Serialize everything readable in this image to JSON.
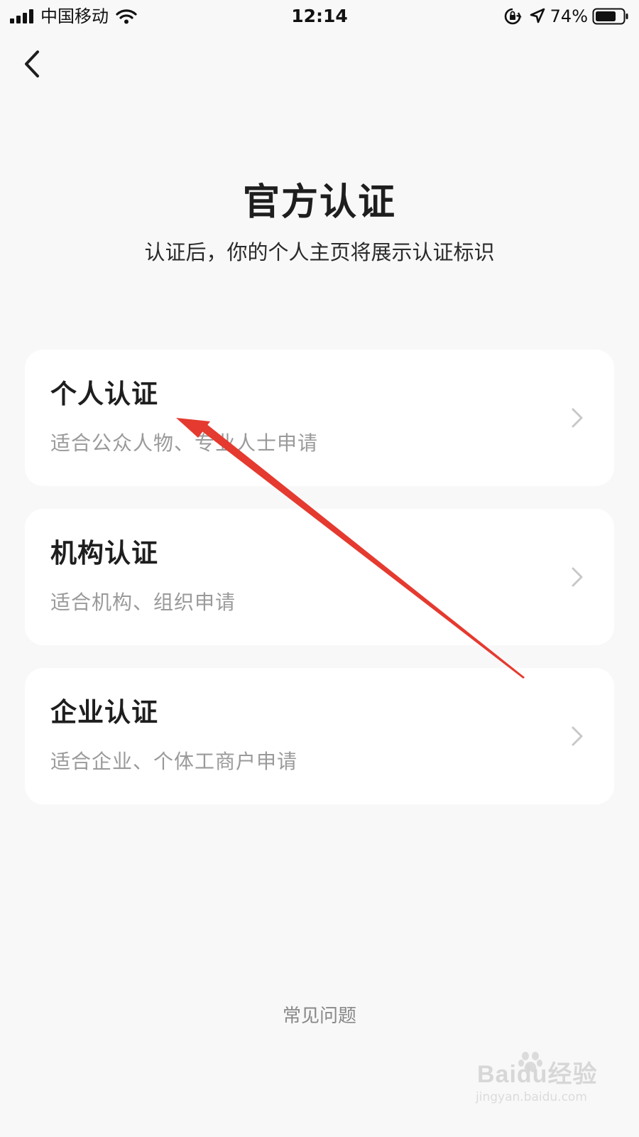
{
  "status_bar": {
    "carrier": "中国移动",
    "time": "12:14",
    "battery": "74%"
  },
  "header": {
    "back_icon": "chevron-left-icon"
  },
  "main": {
    "title": "官方认证",
    "subtitle": "认证后，你的个人主页将展示认证标识",
    "cards": [
      {
        "title": "个人认证",
        "desc": "适合公众人物、专业人士申请"
      },
      {
        "title": "机构认证",
        "desc": "适合机构、组织申请"
      },
      {
        "title": "企业认证",
        "desc": "适合企业、个体工商户申请"
      }
    ],
    "faq_label": "常见问题"
  },
  "annotation": {
    "color": "#e53a2f"
  },
  "watermark": {
    "brand": "Baidu经验",
    "url": "jingyan.baidu.com"
  }
}
